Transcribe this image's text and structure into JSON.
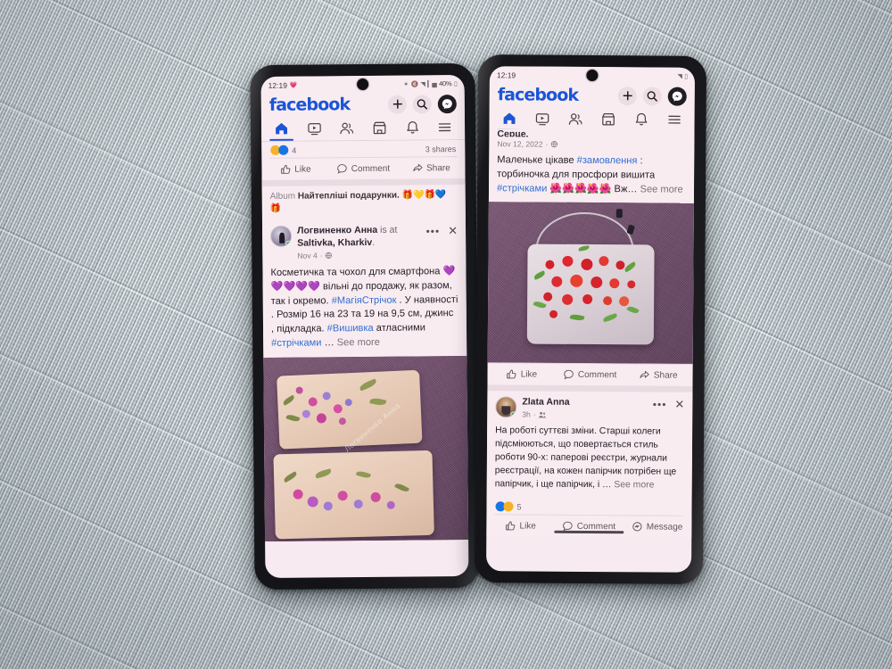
{
  "scene": {
    "description": "Two smartphones side by side on a woven gray rattan surface, both showing the Facebook app feed",
    "background_color": "#b4bfc4"
  },
  "brand": {
    "logo_text": "facebook",
    "logo_color": "#1b55d6"
  },
  "left_phone": {
    "status_bar": {
      "time": "12:19",
      "time_emoji": "💗",
      "icons": [
        "bluetooth-icon",
        "mute-icon",
        "wifi-icon",
        "signal-icon"
      ],
      "battery_percent": "40%",
      "battery_icon": "battery-icon"
    },
    "top_actions": [
      {
        "name": "add-post-button",
        "glyph": "+"
      },
      {
        "name": "search-button",
        "glyph": "search-icon"
      },
      {
        "name": "messenger-button",
        "glyph": "messenger-icon"
      }
    ],
    "nav_tabs": [
      {
        "name": "tab-home",
        "icon": "home-icon",
        "active": true
      },
      {
        "name": "tab-video",
        "icon": "video-icon",
        "active": false
      },
      {
        "name": "tab-friends",
        "icon": "friends-icon",
        "active": false
      },
      {
        "name": "tab-marketplace",
        "icon": "marketplace-icon",
        "active": false
      },
      {
        "name": "tab-notifications",
        "icon": "bell-icon",
        "active": false
      },
      {
        "name": "tab-menu",
        "icon": "hamburger-icon",
        "active": false
      }
    ],
    "partial_post": {
      "reaction_count": "4",
      "reactions": [
        "haha",
        "like"
      ],
      "shares": "3 shares",
      "actions": [
        "Like",
        "Comment",
        "Share"
      ]
    },
    "album_row": {
      "label": "Album",
      "title": "Найтепліші подарунки. 🎁💛🎁💙🎁"
    },
    "post": {
      "author": "Логвиненко Анна",
      "action_word": "is",
      "location_prefix": "at",
      "location": "Saltivka, Kharkiv",
      "location_suffix": ".",
      "timestamp": "Nov 4",
      "privacy_icon": "globe-icon",
      "more_icon": "ellipsis-icon",
      "close_icon": "close-icon",
      "body_segments": [
        {
          "t": "Косметичка та чохол для смартфона 💜💜💜💜💜 вільні до продажу, як разом, так і окремо. ",
          "k": "text"
        },
        {
          "t": "#МагіяСтрічок",
          "k": "tag"
        },
        {
          "t": " . У наявності . Розмір 16 на 23 та 19 на 9,5 см, джинс , підкладка. ",
          "k": "text"
        },
        {
          "t": "#Вишивка",
          "k": "tag"
        },
        {
          "t": " атласними ",
          "k": "text"
        },
        {
          "t": "#стрічками",
          "k": "tag"
        },
        {
          "t": " … ",
          "k": "text"
        },
        {
          "t": "See more",
          "k": "more"
        }
      ],
      "photo_alt": "Two beige embroidered pouches with pink and purple ribbon flowers on a purple cloth",
      "photo_watermark": "Логвиненко Анна"
    }
  },
  "right_phone": {
    "status_bar": {
      "time": "12:19",
      "icons": [
        "wifi-icon",
        "battery-icon"
      ]
    },
    "top_actions": [
      {
        "name": "add-post-button",
        "glyph": "+"
      },
      {
        "name": "search-button",
        "glyph": "search-icon"
      },
      {
        "name": "messenger-button",
        "glyph": "messenger-icon"
      }
    ],
    "nav_tabs": [
      {
        "name": "tab-home",
        "icon": "home-icon",
        "active": true
      },
      {
        "name": "tab-video",
        "icon": "video-icon",
        "active": false
      },
      {
        "name": "tab-friends",
        "icon": "friends-icon",
        "active": false
      },
      {
        "name": "tab-marketplace",
        "icon": "marketplace-icon",
        "active": false
      },
      {
        "name": "tab-notifications",
        "icon": "bell-icon",
        "active": false
      },
      {
        "name": "tab-menu",
        "icon": "hamburger-icon",
        "active": false
      }
    ],
    "post_top": {
      "clipped_line": "Серце.",
      "timestamp": "Nov 12, 2022",
      "privacy_icon": "globe-icon",
      "body_segments": [
        {
          "t": "Маленьке цікаве ",
          "k": "text"
        },
        {
          "t": "#замовлення",
          "k": "tag"
        },
        {
          "t": " : торбиночка для просфори вишита ",
          "k": "text"
        },
        {
          "t": "#стрічками",
          "k": "tag"
        },
        {
          "t": " 🌺🌺🌺🌺🌺 Вж… ",
          "k": "text"
        },
        {
          "t": "See more",
          "k": "more"
        }
      ],
      "photo_alt": "Drawstring pouch embroidered with red ribbon roses on a purple cloth",
      "actions": [
        "Like",
        "Comment",
        "Share"
      ]
    },
    "post_bottom": {
      "author": "Zlata Anna",
      "timestamp": "3h",
      "privacy_icon": "friends-icon",
      "more_icon": "ellipsis-icon",
      "close_icon": "close-icon",
      "body_segments": [
        {
          "t": "На роботі суттєві зміни. Старші колеги підсміюються, що повертається стиль роботи 90-х: паперові реєстри, журнали реєстрації, на кожен папірчик потрібен ще папірчик, і ще папірчик, і … ",
          "k": "text"
        },
        {
          "t": "See more",
          "k": "more"
        }
      ],
      "reaction_count": "5",
      "reactions": [
        "like",
        "haha"
      ],
      "actions": [
        "Like",
        "Comment",
        "Message"
      ]
    }
  }
}
